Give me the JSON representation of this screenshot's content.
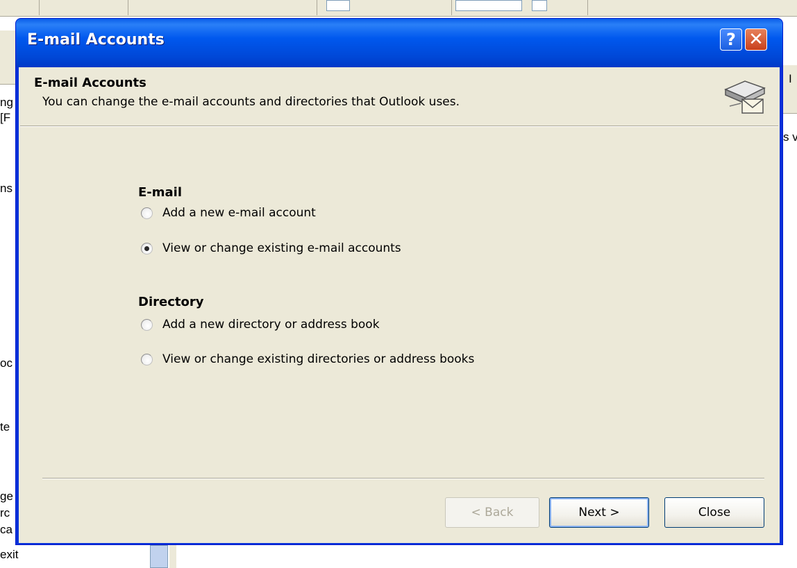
{
  "background": {
    "fragments": [
      "ng",
      "[F",
      "ns",
      "oc",
      "te",
      "ge",
      "rc",
      "ca",
      "exit",
      "I",
      "s v"
    ]
  },
  "dialog": {
    "window_title": "E-mail Accounts",
    "help_button": "?",
    "close_button": "✕",
    "header": {
      "title": "E-mail Accounts",
      "subtitle": "You can change the e-mail accounts and directories that Outlook uses."
    },
    "email_group": {
      "heading": "E-mail",
      "options": [
        {
          "label": "Add a new e-mail account",
          "checked": false
        },
        {
          "label": "View or change existing e-mail accounts",
          "checked": true
        }
      ]
    },
    "directory_group": {
      "heading": "Directory",
      "options": [
        {
          "label": "Add a new directory or address book",
          "checked": false
        },
        {
          "label": "View or change existing directories or address books",
          "checked": false
        }
      ]
    },
    "buttons": {
      "back": "< Back",
      "next": "Next >",
      "close": "Close"
    }
  }
}
